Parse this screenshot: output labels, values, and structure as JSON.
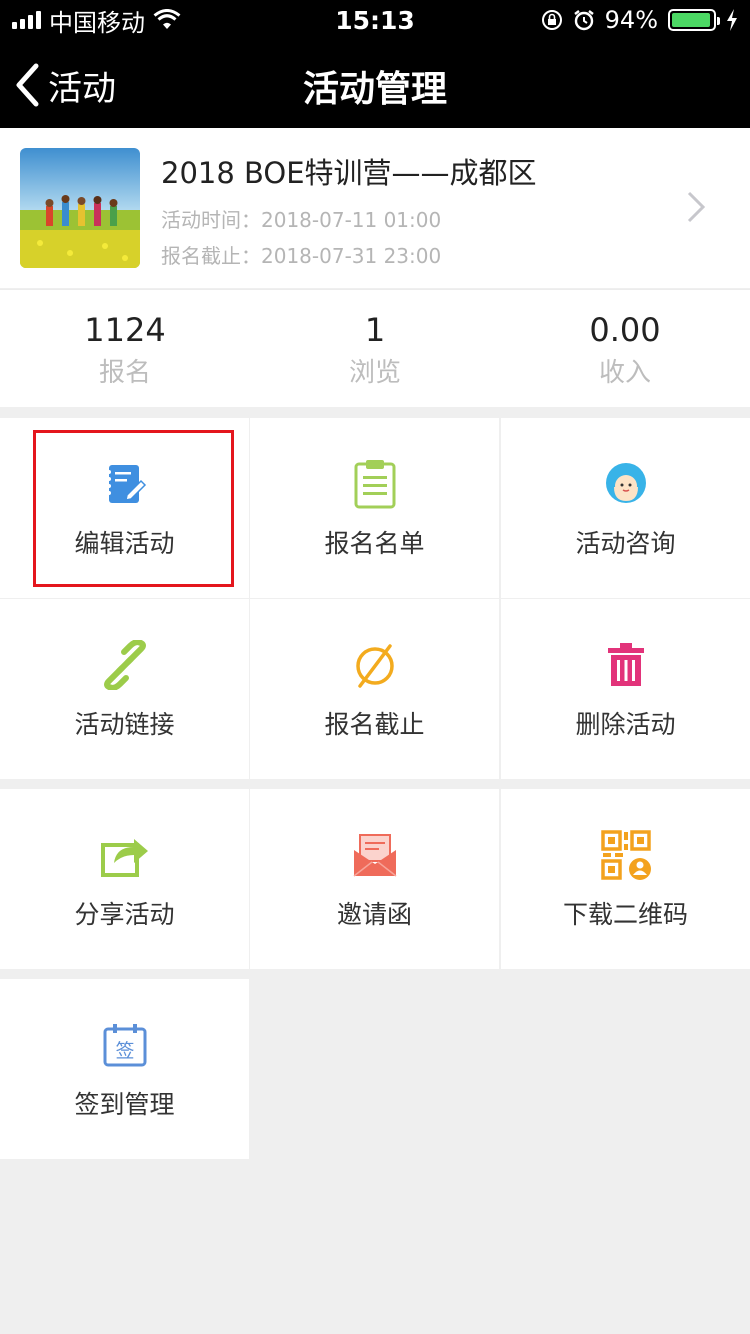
{
  "status_bar": {
    "carrier": "中国移动",
    "time": "15:13",
    "battery": "94%",
    "battery_level": 0.94
  },
  "nav": {
    "back_label": "活动",
    "title": "活动管理"
  },
  "event": {
    "title": "2018 BOE特训营——成都区",
    "time_line": "活动时间：2018-07-11 01:00",
    "deadline_line": "报名截止：2018-07-31 23:00"
  },
  "stats": [
    {
      "value": "1124",
      "label": "报名"
    },
    {
      "value": "1",
      "label": "浏览"
    },
    {
      "value": "0.00",
      "label": "收入"
    }
  ],
  "actions": [
    {
      "label": "编辑活动",
      "icon": "edit-notebook-icon",
      "color": "#3f8fe0"
    },
    {
      "label": "报名名单",
      "icon": "clipboard-list-icon",
      "color": "#a2cf58"
    },
    {
      "label": "活动咨询",
      "icon": "customer-service-icon",
      "color": "#38b3e8"
    },
    {
      "label": "活动链接",
      "icon": "link-icon",
      "color": "#9ccc4a"
    },
    {
      "label": "报名截止",
      "icon": "empty-set-icon",
      "color": "#f3ab1e"
    },
    {
      "label": "删除活动",
      "icon": "trash-icon",
      "color": "#e2337a"
    },
    {
      "label": "分享活动",
      "icon": "share-icon",
      "color": "#9ccc4a"
    },
    {
      "label": "邀请函",
      "icon": "envelope-icon",
      "color": "#ef6b5a"
    },
    {
      "label": "下载二维码",
      "icon": "qr-code-icon",
      "color": "#f3a21e"
    },
    {
      "label": "签到管理",
      "icon": "sign-in-calendar-icon",
      "color": "#5b8fd8",
      "glyph": "签"
    }
  ]
}
